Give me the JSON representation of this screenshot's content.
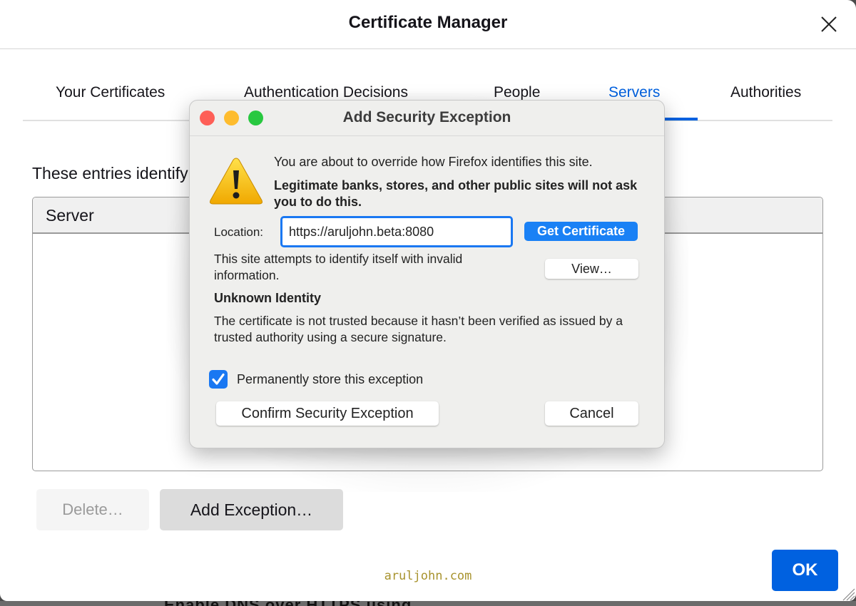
{
  "background_page": {
    "partial_text": "Enable DNS over HTTPS using"
  },
  "certificate_manager": {
    "title": "Certificate Manager",
    "close_icon": "close-icon",
    "tabs": [
      {
        "label": "Your Certificates",
        "active": false
      },
      {
        "label": "Authentication Decisions",
        "active": false
      },
      {
        "label": "People",
        "active": false
      },
      {
        "label": "Servers",
        "active": true
      },
      {
        "label": "Authorities",
        "active": false
      }
    ],
    "intro_text": "These entries identify server certificate error exceptions",
    "table": {
      "columns": [
        "Server"
      ],
      "rows": []
    },
    "buttons": {
      "delete": "Delete…",
      "add_exception": "Add Exception…",
      "ok": "OK"
    },
    "watermark": "aruljohn.com",
    "colors": {
      "accent": "#0061e0",
      "watermark": "#a8932e"
    }
  },
  "dialog": {
    "title": "Add Security Exception",
    "warning_icon": "warning-triangle-icon",
    "message": "You are about to override how Firefox identifies this site.",
    "warning_bold": "Legitimate banks, stores, and other public sites will not ask you to do this.",
    "location_label": "Location:",
    "location_value": "https://aruljohn.beta:8080",
    "get_certificate": "Get Certificate",
    "invalid_info": "This site attempts to identify itself with invalid information.",
    "view_button": "View…",
    "identity_heading": "Unknown Identity",
    "identity_description": "The certificate is not trusted because it hasn’t been verified as issued by a trusted authority using a secure signature.",
    "permanent_checkbox": {
      "label": "Permanently store this exception",
      "checked": true
    },
    "confirm_button": "Confirm Security Exception",
    "cancel_button": "Cancel",
    "colors": {
      "traffic_close": "#fe5f57",
      "traffic_minimize": "#febc2e",
      "traffic_zoom": "#28c840",
      "focus": "#1a78f2"
    }
  }
}
